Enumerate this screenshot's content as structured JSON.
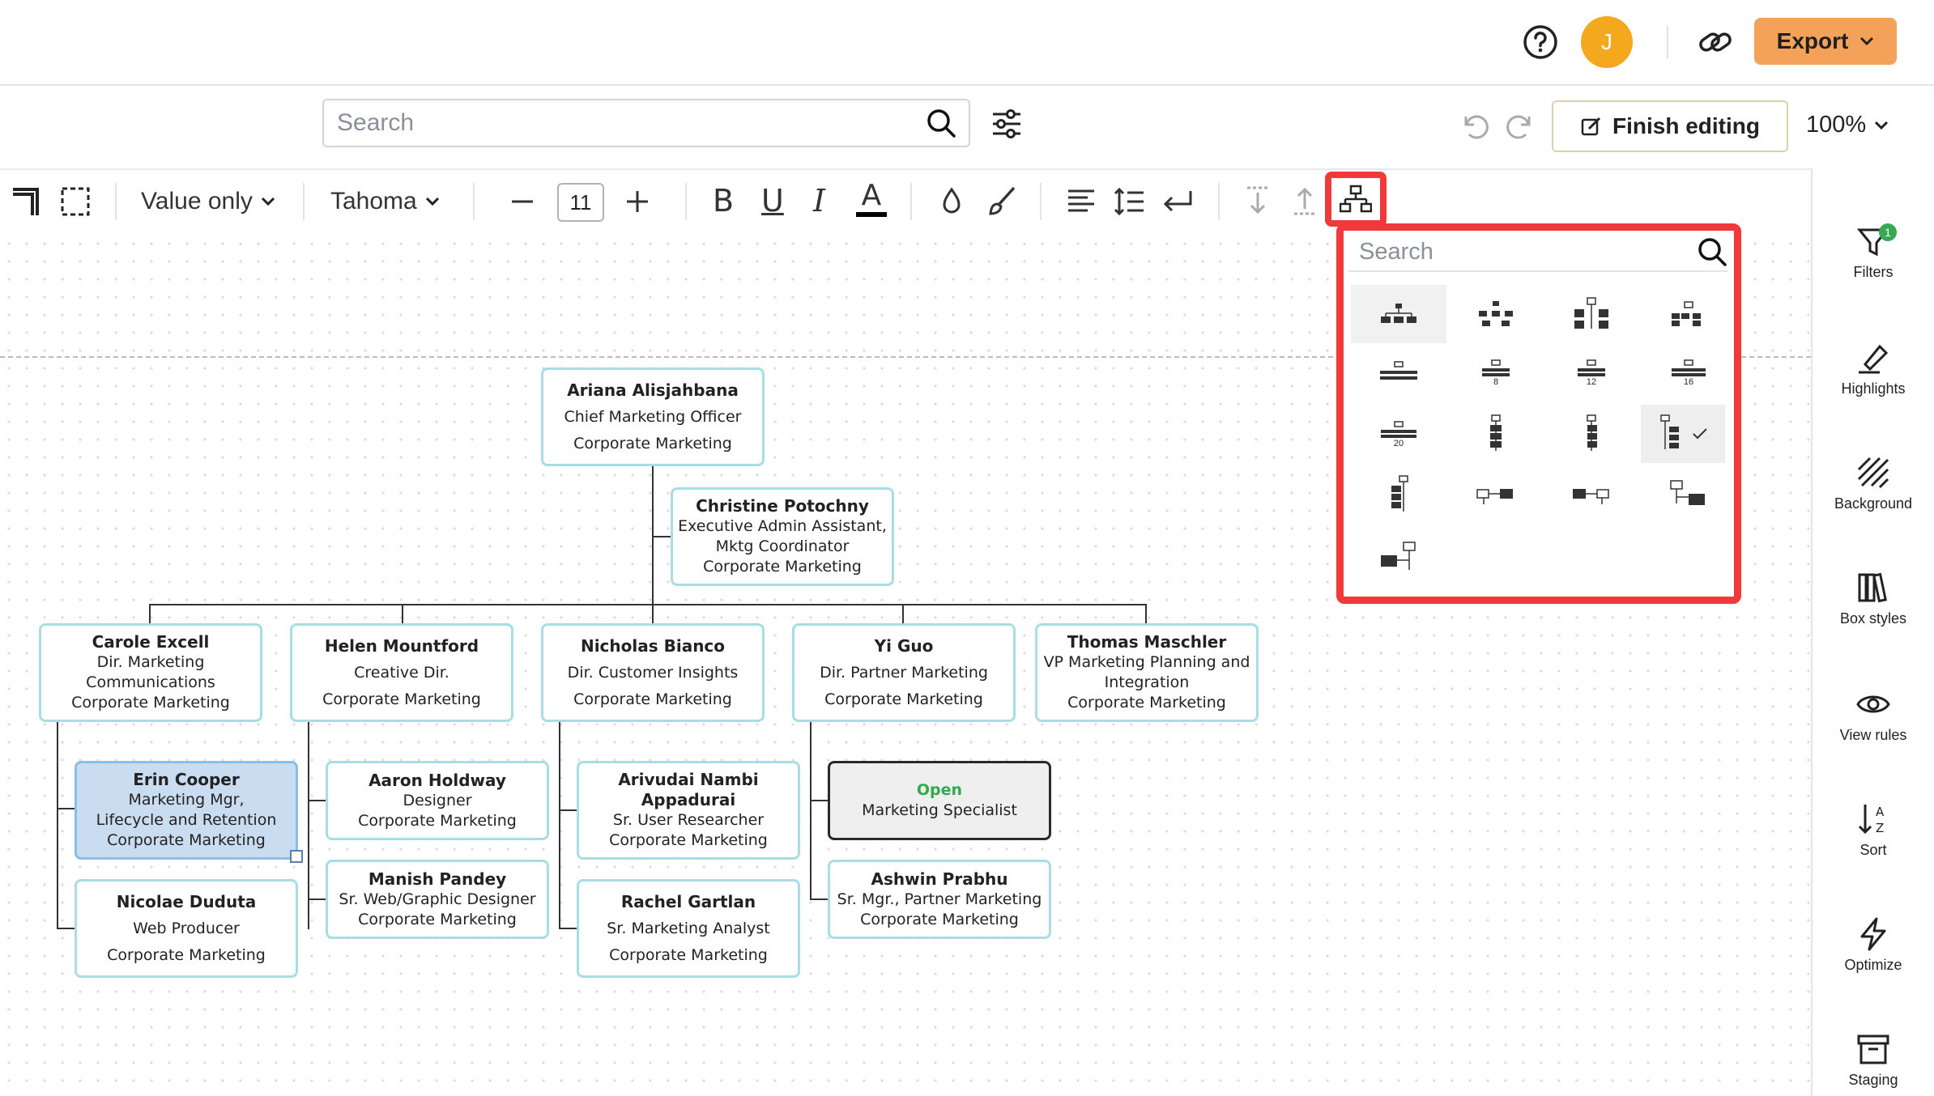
{
  "header": {
    "help_icon": "help-circle-icon",
    "avatar_initial": "J",
    "share_icon": "link-icon",
    "export_label": "Export"
  },
  "secondbar": {
    "search_placeholder": "Search",
    "finish_label": "Finish editing",
    "zoom": "100%"
  },
  "toolbar": {
    "value_mode": "Value only",
    "font": "Tahoma",
    "font_size": "11",
    "bold": "B",
    "underline": "U",
    "italic": "I",
    "font_color": "A",
    "font_color_hex": "#000000"
  },
  "layout_popover": {
    "search_placeholder": "Search",
    "options": [
      "1",
      "2",
      "3",
      "4",
      "5",
      "8",
      "12",
      "16",
      "20",
      "s1",
      "s2",
      "s3",
      "s4",
      "h1",
      "h2",
      "h3",
      "h4"
    ],
    "labels": {
      "n8": "8",
      "n12": "12",
      "n16": "16",
      "n20": "20"
    },
    "selected_index": 11
  },
  "right_rail": {
    "filters": "Filters",
    "filters_badge": "1",
    "highlights": "Highlights",
    "background": "Background",
    "box_styles": "Box styles",
    "view_rules": "View rules",
    "sort": "Sort",
    "optimize": "Optimize",
    "staging": "Staging"
  },
  "org": {
    "ceo": {
      "name": "Ariana Alisjahbana",
      "title": "Chief Marketing Officer",
      "dept": "Corporate Marketing"
    },
    "assistant": {
      "name": "Christine Potochny",
      "title": "Executive Admin Assistant, Mktg Coordinator",
      "dept": "Corporate Marketing"
    },
    "carole": {
      "name": "Carole Excell",
      "title": "Dir. Marketing Communications",
      "dept": "Corporate Marketing"
    },
    "helen": {
      "name": "Helen Mountford",
      "title": "Creative Dir.",
      "dept": "Corporate Marketing"
    },
    "nicholas": {
      "name": "Nicholas Bianco",
      "title": "Dir. Customer Insights",
      "dept": "Corporate Marketing"
    },
    "yi": {
      "name": "Yi Guo",
      "title": "Dir. Partner Marketing",
      "dept": "Corporate Marketing"
    },
    "thomas": {
      "name": "Thomas Maschler",
      "title": "VP Marketing Planning and Integration",
      "dept": "Corporate Marketing"
    },
    "erin": {
      "name": "Erin Cooper",
      "title": "Marketing Mgr, Lifecycle and Retention",
      "dept": "Corporate Marketing"
    },
    "nicolae": {
      "name": "Nicolae Duduta",
      "title": "Web Producer",
      "dept": "Corporate Marketing"
    },
    "aaron": {
      "name": "Aaron Holdway",
      "title": "Designer",
      "dept": "Corporate Marketing"
    },
    "manish": {
      "name": "Manish Pandey",
      "title": "Sr. Web/Graphic Designer",
      "dept": "Corporate Marketing"
    },
    "arivudai": {
      "name": "Arivudai Nambi Appadurai",
      "title": "Sr. User Researcher",
      "dept": "Corporate Marketing"
    },
    "rachel": {
      "name": "Rachel Gartlan",
      "title": "Sr. Marketing Analyst",
      "dept": "Corporate Marketing"
    },
    "open": {
      "name": "Open",
      "title": "Marketing Specialist"
    },
    "ashwin": {
      "name": "Ashwin Prabhu",
      "title": "Sr. Mgr., Partner Marketing",
      "dept": "Corporate Marketing"
    }
  }
}
